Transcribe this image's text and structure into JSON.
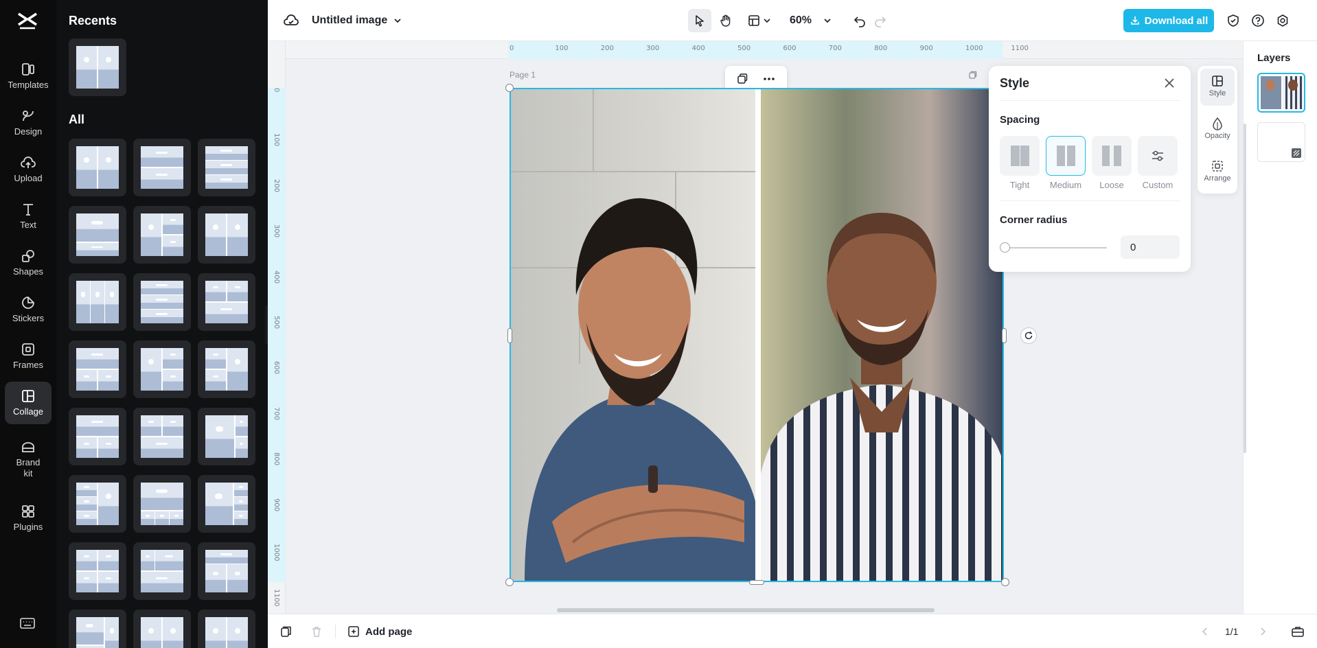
{
  "rail": {
    "items": [
      {
        "label": "Templates",
        "icon": "templates-icon"
      },
      {
        "label": "Design",
        "icon": "design-icon"
      },
      {
        "label": "Upload",
        "icon": "upload-icon"
      },
      {
        "label": "Text",
        "icon": "text-icon"
      },
      {
        "label": "Shapes",
        "icon": "shapes-icon"
      },
      {
        "label": "Stickers",
        "icon": "stickers-icon"
      },
      {
        "label": "Frames",
        "icon": "frames-icon"
      },
      {
        "label": "Collage",
        "icon": "collage-icon",
        "active": true
      },
      {
        "label": "Brand kit",
        "icon": "brand-kit-icon"
      },
      {
        "label": "Plugins",
        "icon": "plugins-icon"
      }
    ]
  },
  "panel": {
    "recents_title": "Recents",
    "all_title": "All"
  },
  "topbar": {
    "title": "Untitled image",
    "zoom": "60%",
    "download_label": "Download all"
  },
  "canvas": {
    "page_label": "Page 1",
    "ruler_top": [
      "0",
      "100",
      "200",
      "300",
      "400",
      "500",
      "600",
      "700",
      "800",
      "900",
      "1000",
      "1100"
    ],
    "ruler_left": [
      "0",
      "100",
      "200",
      "300",
      "400",
      "500",
      "600",
      "700",
      "800",
      "900",
      "1000",
      "1100"
    ]
  },
  "style_panel": {
    "title": "Style",
    "spacing_title": "Spacing",
    "spacing_options": [
      "Tight",
      "Medium",
      "Loose",
      "Custom"
    ],
    "spacing_selected": "Medium",
    "corner_title": "Corner radius",
    "corner_value": "0"
  },
  "side_tabs": [
    "Style",
    "Opacity",
    "Arrange"
  ],
  "layers": {
    "title": "Layers"
  },
  "bottombar": {
    "add_page": "Add page",
    "pages": "1/1"
  },
  "colors": {
    "accent": "#25b8e4",
    "download": "#1db8e8",
    "rail_bg": "#0c0c0d"
  }
}
